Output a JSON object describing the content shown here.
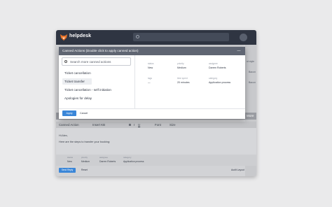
{
  "app": {
    "brand": "helpdesk"
  },
  "modal": {
    "title": "Canned Actions (Double click to apply canned action)",
    "close_glyph": "—",
    "search_placeholder": "Search more canned actions",
    "items": [
      {
        "label": "Ticket cancellation",
        "active": false
      },
      {
        "label": "Ticket transfer",
        "active": true
      },
      {
        "label": "Ticket cancellation - self initiation",
        "active": false
      },
      {
        "label": "Apologies for delay",
        "active": false
      }
    ],
    "fields": {
      "status_label": "status",
      "status_value": "New",
      "priority_label": "priority",
      "priority_value": "Medium",
      "assignee_label": "assignee",
      "assignee_value": "Darren Roberts",
      "tags_label": "tags",
      "tags_value": "—",
      "time_spent_label": "time spent",
      "time_spent_value": "20 minutes",
      "category_label": "category",
      "category_value": "Application process"
    },
    "apply_label": "Apply",
    "cancel_label": "Cancel"
  },
  "background": {
    "right_text_1": "nt style",
    "right_text_2": "Bacon",
    "right_text_3": "Bacon"
  },
  "reply": {
    "more_label": "More",
    "toolbar": {
      "canned_action": "Canned Action",
      "insert_kb": "Insert KB",
      "bold": "B",
      "italic": "I",
      "underline": "U",
      "font": "Font",
      "size": "Size"
    },
    "greeting": "Hi Alex,",
    "body": "Here are the steps to transfer your booking:",
    "meta": {
      "status_label": "status",
      "status_value": "New",
      "priority_label": "priority",
      "priority_value": "Medium",
      "assignee_label": "assignee",
      "assignee_value": "Darren Roberts",
      "category_label": "category",
      "category_value": "Application process"
    },
    "send_label": "Send Reply",
    "reset_label": "Reset",
    "audit_label": "Audit Layout"
  },
  "colors": {
    "topbar": "#2f3542",
    "accent": "#3a86d8",
    "logo": "#e8742a"
  }
}
